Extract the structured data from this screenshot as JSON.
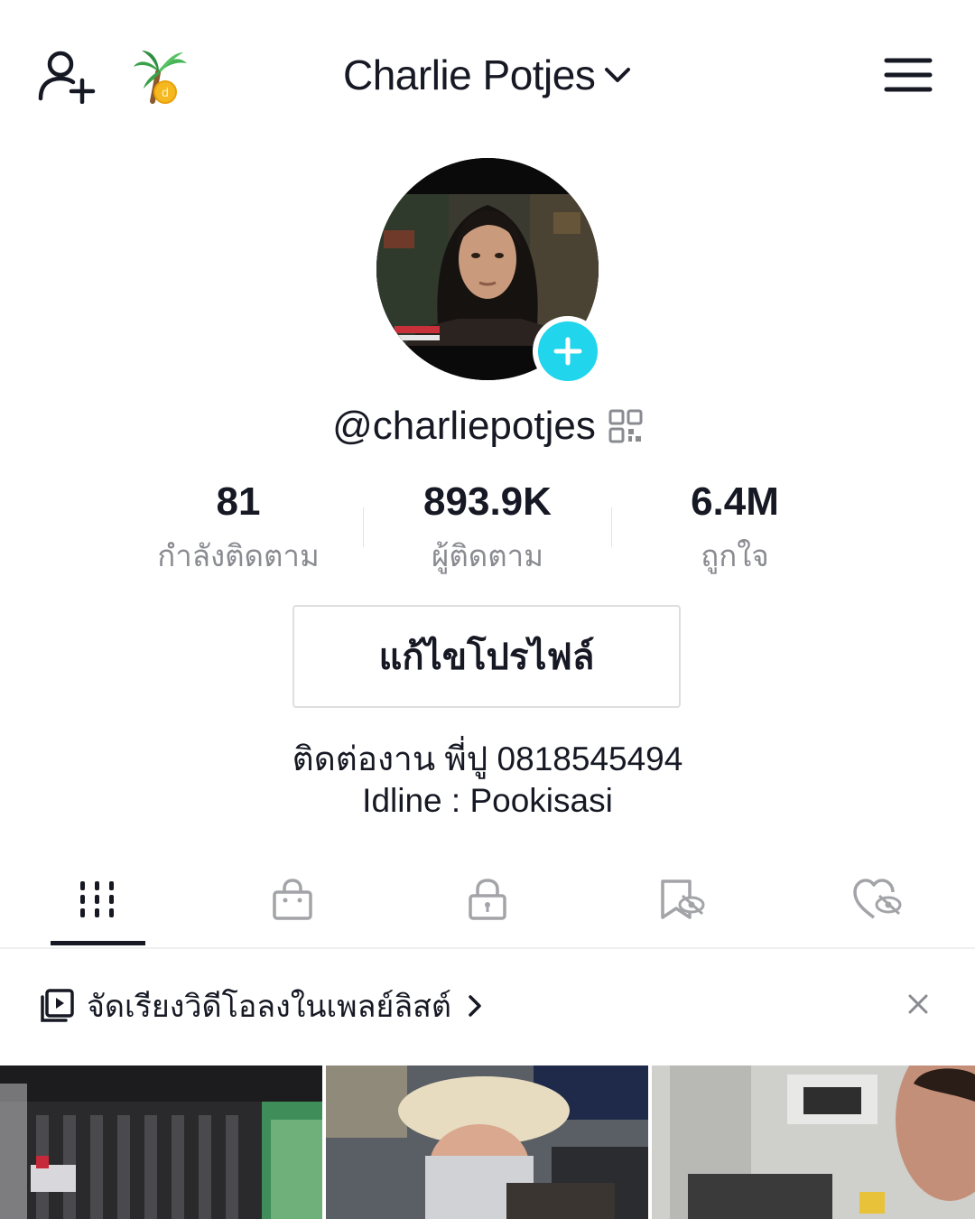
{
  "header": {
    "title": "Charlie Potjes",
    "add_friend_icon": "person-plus-icon",
    "coin_icon": "palm-tree-coin-icon",
    "menu_icon": "hamburger-menu-icon"
  },
  "profile": {
    "handle": "@charliepotjes",
    "avatar": "profile-photo",
    "stats": [
      {
        "value": "81",
        "label": "กำลังติดตาม"
      },
      {
        "value": "893.9K",
        "label": "ผู้ติดตาม"
      },
      {
        "value": "6.4M",
        "label": "ถูกใจ"
      }
    ],
    "edit_button": "แก้ไขโปรไฟล์",
    "bio_line1": "ติดต่องาน พี่ปู 0818545494",
    "bio_line2": "Idline : Pookisasi"
  },
  "tabs": [
    {
      "icon": "video-grid-icon",
      "active": true
    },
    {
      "icon": "shopping-bag-icon",
      "active": false
    },
    {
      "icon": "lock-icon",
      "active": false
    },
    {
      "icon": "bookmark-hidden-icon",
      "active": false
    },
    {
      "icon": "heart-hidden-icon",
      "active": false
    }
  ],
  "playlist_banner": {
    "text": "จัดเรียงวิดีโอลงในเพลย์ลิสต์"
  },
  "colors": {
    "accent": "#20d5ec",
    "text_primary": "#161823",
    "text_secondary": "#8a8b91"
  }
}
